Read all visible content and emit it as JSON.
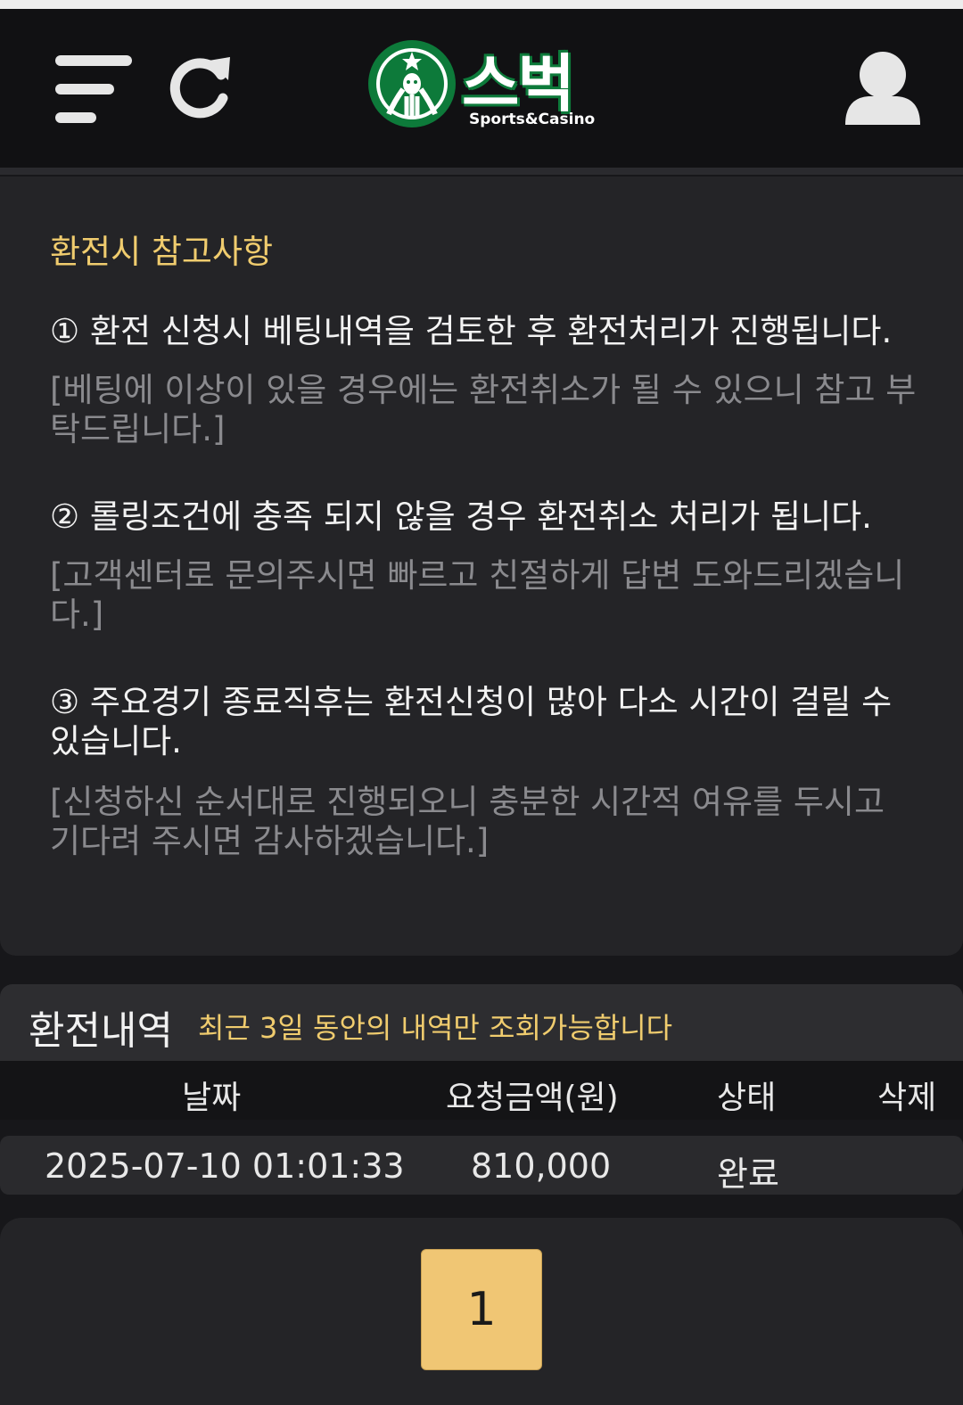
{
  "header": {
    "icons": {
      "menu": "hamburger-menu-icon",
      "refresh": "refresh-icon",
      "user": "user-icon"
    },
    "brand_text": "스벅",
    "brand_sub": "Sports&Casino",
    "colors": {
      "brand_green": "#0d7a3a",
      "logo_white": "#ffffff"
    }
  },
  "notice": {
    "title": "환전시 참고사항",
    "items": [
      {
        "main": "① 환전 신청시 베팅내역을 검토한 후 환전처리가 진행됩니다.",
        "sub": "[베팅에 이상이 있을 경우에는 환전취소가 될 수 있으니 참고 부탁드립니다.]"
      },
      {
        "main": "② 롤링조건에 충족 되지 않을 경우 환전취소 처리가 됩니다.",
        "sub": "[고객센터로 문의주시면 빠르고 친절하게 답변 도와드리겠습니다.]"
      },
      {
        "main": "③ 주요경기 종료직후는 환전신청이 많아 다소 시간이 걸릴 수 있습니다.",
        "sub": "[신청하신 순서대로 진행되오니 충분한 시간적 여유를 두시고 기다려 주시면 감사하겠습니다.]"
      }
    ],
    "colors": {
      "title": "#f0cc6e",
      "main": "#f2f2f2",
      "sub": "#8a8a8e"
    }
  },
  "history": {
    "title": "환전내역",
    "note": "최근 3일 동안의 내역만 조회가능합니다",
    "columns": [
      "날짜",
      "요청금액(원)",
      "상태",
      "삭제"
    ],
    "rows": [
      {
        "date": "2025-07-10 01:01:33",
        "amount": "810,000",
        "status": "완료",
        "delete": ""
      }
    ]
  },
  "pagination": {
    "current": "1",
    "accent": "#f0c674"
  }
}
